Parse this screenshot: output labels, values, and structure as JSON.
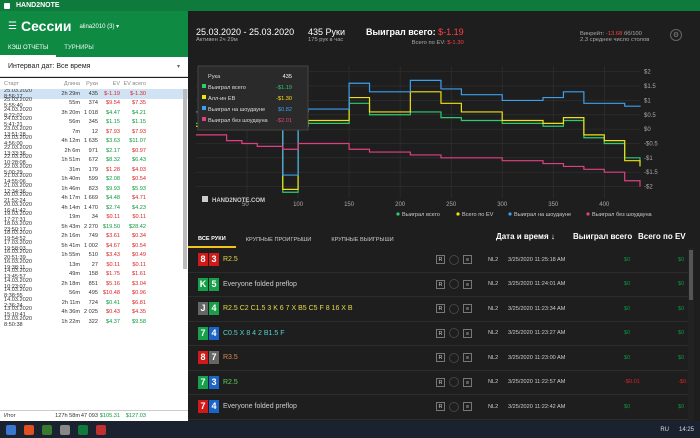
{
  "app": {
    "title": "HAND2NOTE"
  },
  "header": {
    "title": "Сессии",
    "account": "alina2010 (3) ▾"
  },
  "tabs": [
    "КЭШ ОТЧЕТЫ",
    "ТУРНИРЫ"
  ],
  "filter": {
    "label": "Интервал дат:",
    "value": "Все время"
  },
  "columns": [
    "Старт",
    "Длина",
    "Руки",
    "EV",
    "EV всего"
  ],
  "sessions": [
    [
      "25.03.2020 8:56:17",
      "2h 29m",
      "435",
      "$-1.19",
      "$-1.30"
    ],
    [
      "25.03.2020 5:55:40",
      "55m",
      "374",
      "$9.54",
      "$7.35"
    ],
    [
      "24.03.2020 8:22:07",
      "3h 20m",
      "1 018",
      "$4.47",
      "$4.21"
    ],
    [
      "24.03.2020 5:41:21",
      "56m",
      "345",
      "$1.15",
      "$1.15"
    ],
    [
      "23.03.2020 13:51:28",
      "7m",
      "12",
      "$7.93",
      "$7.93"
    ],
    [
      "23.03.2020 4:56:00",
      "4h 12m",
      "1 635",
      "$3.63",
      "$11.07"
    ],
    [
      "22.03.2020 13:33:36",
      "2h 6m",
      "971",
      "$2.17",
      "$0.97"
    ],
    [
      "22.03.2020 10:28:08",
      "1h 51m",
      "672",
      "$8.32",
      "$6.43"
    ],
    [
      "22.03.2020 5:00:29",
      "31m",
      "179",
      "$1.28",
      "$4.03"
    ],
    [
      "21.03.2020 14:55:06",
      "1h 40m",
      "599",
      "$2.08",
      "$0.54"
    ],
    [
      "21.03.2020 12:34:36",
      "1h 46m",
      "823",
      "$9.93",
      "$5.93"
    ],
    [
      "20.03.2020 21:52:24",
      "4h 17m",
      "1 669",
      "$4.48",
      "$4.71"
    ],
    [
      "20.03.2020 16:41:42",
      "4h 14m",
      "1 470",
      "$2.74",
      "$4.23"
    ],
    [
      "19.03.2020 17:27:31",
      "19m",
      "34",
      "$0.11",
      "$0.11"
    ],
    [
      "18.03.2020 23:50:17",
      "5h 43m",
      "2 270",
      "$19.50",
      "$28.42"
    ],
    [
      "18.03.2020 19:54:52",
      "2h 16m",
      "749",
      "$3.61",
      "$0.34"
    ],
    [
      "17.03.2020 19:58:03",
      "5h 41m",
      "1 002",
      "$4.67",
      "$0.54"
    ],
    [
      "16.03.2020 20:51:39",
      "1h 55m",
      "510",
      "$3.43",
      "$0.49"
    ],
    [
      "16.03.2020 19:38:11",
      "13m",
      "27",
      "$0.11",
      "$0.11"
    ],
    [
      "14.03.2020 13:45:57",
      "49m",
      "158",
      "$1.75",
      "$1.61"
    ],
    [
      "14.03.2020 10:23:07",
      "2h 18m",
      "851",
      "$5.16",
      "$3.04"
    ],
    [
      "14.03.2020 8:38:55",
      "56m",
      "495",
      "$10.48",
      "$0.96"
    ],
    [
      "14.03.2020 2:36:24",
      "2h 11m",
      "724",
      "$0.41",
      "$6.81"
    ],
    [
      "13.03.2020 15:10:41",
      "4h 36m",
      "2 025",
      "$0.43",
      "$4.35"
    ],
    [
      "12.03.2020 8:50:38",
      "1h 22m",
      "322",
      "$4.37",
      "$9.58"
    ]
  ],
  "sessions_colors": [
    [
      "r",
      "r"
    ],
    [
      "r",
      "r"
    ],
    [
      "g",
      "g"
    ],
    [
      "g",
      "g"
    ],
    [
      "r",
      "r"
    ],
    [
      "g",
      "g"
    ],
    [
      "g",
      "r"
    ],
    [
      "g",
      "g"
    ],
    [
      "r",
      "r"
    ],
    [
      "g",
      "r"
    ],
    [
      "g",
      "g"
    ],
    [
      "g",
      "r"
    ],
    [
      "g",
      "g"
    ],
    [
      "r",
      "r"
    ],
    [
      "g",
      "g"
    ],
    [
      "r",
      "r"
    ],
    [
      "r",
      "r"
    ],
    [
      "r",
      "r"
    ],
    [
      "r",
      "r"
    ],
    [
      "r",
      "r"
    ],
    [
      "r",
      "r"
    ],
    [
      "r",
      "r"
    ],
    [
      "g",
      "r"
    ],
    [
      "r",
      "r"
    ],
    [
      "g",
      "g"
    ]
  ],
  "footer": {
    "label": "Итог",
    "length": "127h 58m",
    "hands": "47 093",
    "ev": "$105.31",
    "ev_total": "$127.03"
  },
  "stats": {
    "dates": "25.03.2020 - 25.03.2020",
    "active": "Активен 2ч 29м",
    "hands": "435 Руки",
    "per_hour": "175 рук в час",
    "won_label": "Выиграл всего:",
    "won_value": "$-1.19",
    "ev_label": "Всего по EV:",
    "ev_value": "$-1.30",
    "winrate_label": "Винрейт:",
    "winrate_value": "-13.68",
    "winrate_unit": "бб/100",
    "tables": "2.3 среднее число столов"
  },
  "tooltip": {
    "rows": [
      [
        "Рука",
        "435"
      ],
      [
        "Выиграл всего",
        "-$1.19"
      ],
      [
        "Алл-ин EB",
        "-$1.30"
      ],
      [
        "Выиграл на шоудауне",
        "$0.82"
      ],
      [
        "Выиграл без шоудауна",
        "-$2.01"
      ]
    ]
  },
  "watermark": "HAND2NOTE.COM",
  "chart_data": {
    "type": "line",
    "x_ticks": [
      "50",
      "100",
      "150",
      "200",
      "250",
      "300",
      "350",
      "400"
    ],
    "y_ticks": [
      "$2",
      "$1.5",
      "$1",
      "$0.5",
      "$0",
      "-$0.5",
      "-$1",
      "-$1.5",
      "-$2"
    ],
    "ylim": [
      -2.4,
      2.2
    ],
    "xlim": [
      0,
      435
    ],
    "series": [
      {
        "name": "Выиграл всего",
        "color": "#2ecc71",
        "x": [
          0,
          30,
          45,
          60,
          80,
          85,
          100,
          110,
          150,
          170,
          210,
          240,
          260,
          300,
          340,
          360,
          380,
          400,
          420,
          435
        ],
        "y": [
          0.2,
          0.4,
          0.6,
          0.3,
          0.4,
          -2.2,
          0.1,
          0.2,
          0.9,
          0.5,
          0.6,
          0.4,
          0.3,
          0.2,
          0.1,
          0.3,
          -0.3,
          -0.5,
          -1.0,
          -1.19
        ]
      },
      {
        "name": "Всего по EV",
        "color": "#f0e014",
        "x": [
          0,
          30,
          45,
          60,
          80,
          85,
          100,
          110,
          150,
          170,
          210,
          240,
          260,
          300,
          340,
          360,
          380,
          400,
          420,
          435
        ],
        "y": [
          0.1,
          0.5,
          0.7,
          0.4,
          0.5,
          -2.1,
          0.2,
          0.3,
          1.1,
          0.6,
          1.3,
          0.9,
          0.6,
          0.3,
          0.2,
          0.4,
          -0.2,
          -0.4,
          -1.1,
          -1.3
        ]
      },
      {
        "name": "Выиграл на шоудауне",
        "color": "#3aa0f0",
        "x": [
          0,
          30,
          45,
          60,
          80,
          85,
          100,
          110,
          150,
          170,
          210,
          240,
          260,
          300,
          340,
          360,
          380,
          400,
          420,
          435
        ],
        "y": [
          0.6,
          1.0,
          1.1,
          0.9,
          1.0,
          -1.6,
          0.6,
          0.7,
          1.6,
          1.3,
          1.7,
          1.4,
          1.2,
          1.0,
          1.1,
          1.3,
          0.9,
          0.9,
          0.8,
          0.82
        ]
      },
      {
        "name": "Выиграл без шоудауна",
        "color": "#e04080",
        "x": [
          0,
          30,
          45,
          60,
          80,
          85,
          100,
          110,
          150,
          170,
          210,
          240,
          260,
          300,
          340,
          360,
          380,
          400,
          420,
          435
        ],
        "y": [
          -0.2,
          -0.4,
          -0.5,
          -0.6,
          -0.6,
          -0.7,
          -0.5,
          -0.5,
          -0.7,
          -0.8,
          -0.9,
          -1.0,
          -1.0,
          -1.1,
          -1.2,
          -1.3,
          -1.4,
          -1.5,
          -1.8,
          -2.01
        ]
      }
    ]
  },
  "chart_tabs": [
    "ВСЕ РУКИ",
    "КРУПНЫЕ ПРОИГРЫШИ",
    "КРУПНЫЕ ВЫИГРЫШИ"
  ],
  "hand_headers": {
    "date": "Дата и время ↓",
    "won": "Выиграл всего",
    "ev": "Всего по EV"
  },
  "hands": [
    {
      "cards": [
        [
          "8",
          "cr"
        ],
        [
          "3",
          "cr"
        ]
      ],
      "action": "R2.5",
      "action_color": "#e6d84a",
      "limit": "NL2",
      "date": "3/25/2020 11:25:18 AM",
      "won": "$0",
      "ev": "$0",
      "wc": "g",
      "ec": "g"
    },
    {
      "cards": [
        [
          "K",
          "cg"
        ],
        [
          "5",
          "cg"
        ]
      ],
      "action": "Everyone folded preflop",
      "action_color": "#ccc",
      "limit": "NL2",
      "date": "3/25/2020 11:24:01 AM",
      "won": "$0",
      "ev": "$0",
      "wc": "g",
      "ec": "g"
    },
    {
      "cards": [
        [
          "J",
          "cd"
        ],
        [
          "4",
          "cg"
        ]
      ],
      "action": "R2.5 C2 C1.5 3 K 6 7 X B5 C5 F 8 16 X B",
      "action_color": "#e6d84a",
      "limit": "NL2",
      "date": "3/25/2020 11:23:34 AM",
      "won": "$0",
      "ev": "$0",
      "wc": "g",
      "ec": "g"
    },
    {
      "cards": [
        [
          "7",
          "cg"
        ],
        [
          "4",
          "cb"
        ]
      ],
      "action": "C0.5 X 8 4 2 B1.5 F",
      "action_color": "#5ad0d0",
      "limit": "NL2",
      "date": "3/25/2020 11:23:27 AM",
      "won": "$0",
      "ev": "$0",
      "wc": "g",
      "ec": "g"
    },
    {
      "cards": [
        [
          "8",
          "cr"
        ],
        [
          "7",
          "cd"
        ]
      ],
      "action": "R3.5",
      "action_color": "#e08a4a",
      "limit": "NL2",
      "date": "3/25/2020 11:23:00 AM",
      "won": "$0",
      "ev": "$0",
      "wc": "g",
      "ec": "g"
    },
    {
      "cards": [
        [
          "7",
          "cg"
        ],
        [
          "3",
          "cb"
        ]
      ],
      "action": "R2.5",
      "action_color": "#5ad05a",
      "limit": "NL2",
      "date": "3/25/2020 11:22:57 AM",
      "won": "-$0.01",
      "ev": "-$0.01",
      "wc": "r",
      "ec": "r"
    },
    {
      "cards": [
        [
          "7",
          "cr"
        ],
        [
          "4",
          "cb"
        ]
      ],
      "action": "Everyone folded preflop",
      "action_color": "#ccc",
      "limit": "NL2",
      "date": "3/25/2020 11:22:42 AM",
      "won": "$0",
      "ev": "$0",
      "wc": "g",
      "ec": "g"
    }
  ],
  "taskbar": {
    "lang": "RU",
    "time": "14:25"
  }
}
